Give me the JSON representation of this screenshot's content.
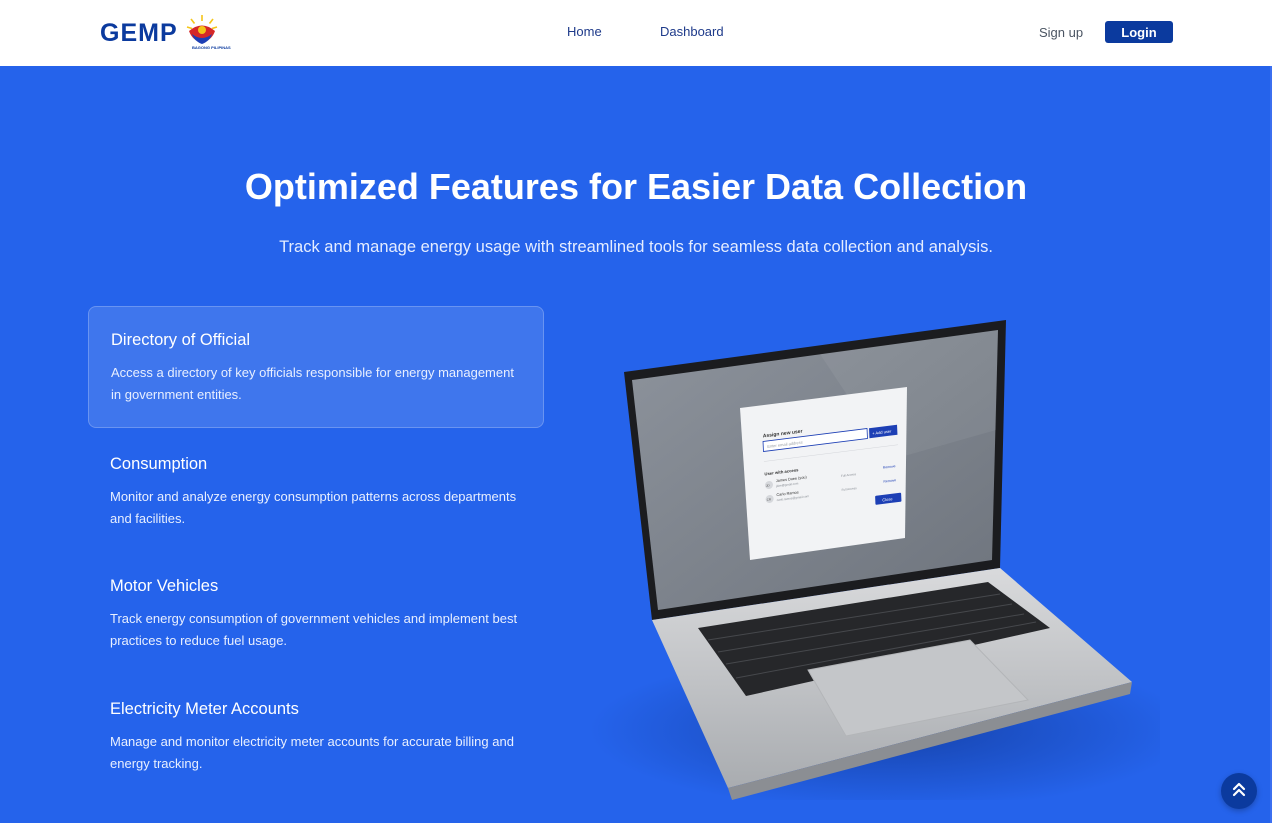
{
  "header": {
    "logo_text": "GEMP",
    "logo_caption": "BAGONG PILIPINAS",
    "nav": {
      "home": "Home",
      "dashboard": "Dashboard"
    },
    "signup": "Sign up",
    "login": "Login"
  },
  "hero": {
    "title": "Optimized Features for Easier Data Collection",
    "subtitle": "Track and manage energy usage with streamlined tools for seamless data collection and analysis."
  },
  "features": [
    {
      "title": "Directory of Official",
      "description": "Access a directory of key officials responsible for energy management in government entities.",
      "active": true
    },
    {
      "title": "Consumption",
      "description": "Monitor and analyze energy consumption patterns across departments and facilities.",
      "active": false
    },
    {
      "title": "Motor Vehicles",
      "description": "Track energy consumption of government vehicles and implement best practices to reduce fuel usage.",
      "active": false
    },
    {
      "title": "Electricity Meter Accounts",
      "description": "Manage and monitor electricity meter accounts for accurate billing and energy tracking.",
      "active": false
    }
  ],
  "laptop_screen": {
    "heading": "Assign new user",
    "input_placeholder": "Enter email address",
    "add_button": "+ Add user",
    "section_label": "User with access",
    "users": [
      {
        "initials": "JD",
        "name": "James Doee (you)",
        "email": "jdoe@gmail.com",
        "role": "Full Access",
        "action": "Remove"
      },
      {
        "initials": "CR",
        "name": "Carlo Ramos",
        "email": "carlo.ramos@gmail.com",
        "role": "Full Access",
        "action": "Remove"
      }
    ],
    "close_button": "Close"
  },
  "icons": {
    "logo_emblem": "sun-emblem-icon",
    "scroll_top": "double-chevron-up-icon"
  },
  "colors": {
    "primary_bg": "#2563eb",
    "brand_navy": "#0b3a9e",
    "header_bg": "#ffffff"
  }
}
